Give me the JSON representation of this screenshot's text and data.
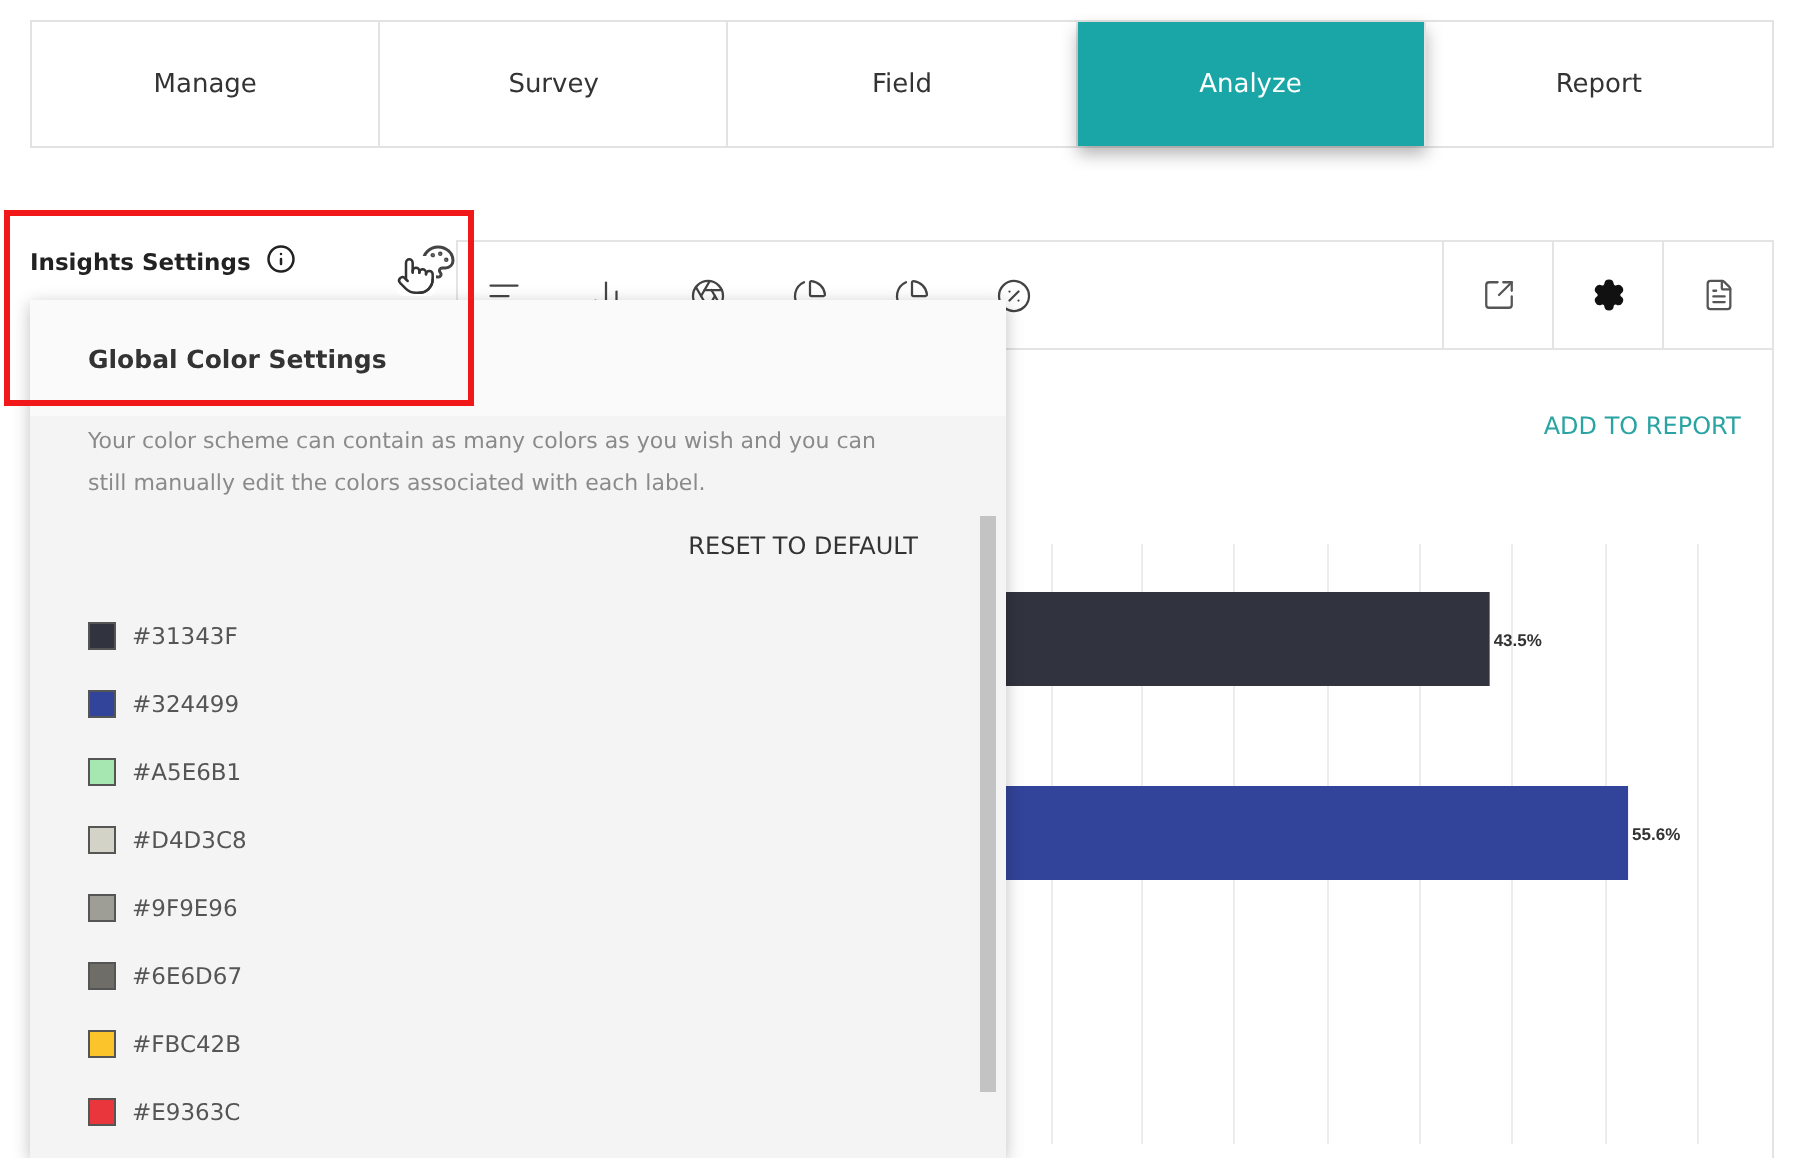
{
  "tabs": [
    {
      "label": "Manage",
      "selected": false
    },
    {
      "label": "Survey",
      "selected": false
    },
    {
      "label": "Field",
      "selected": false
    },
    {
      "label": "Analyze",
      "selected": true
    },
    {
      "label": "Report",
      "selected": false
    }
  ],
  "sidebar": {
    "title": "Insights Settings"
  },
  "toolbar": {
    "add_to_report": "ADD TO REPORT"
  },
  "color_popup": {
    "title": "Global Color Settings",
    "description": "Your color scheme can contain as many colors as you wish and you can still manually edit the colors associated with each label.",
    "reset": "RESET TO DEFAULT",
    "colors": [
      {
        "label": "#31343F",
        "color": "#31343f"
      },
      {
        "label": "#324499",
        "color": "#324499"
      },
      {
        "label": "#A5E6B1",
        "color": "#a5e6b1"
      },
      {
        "label": "#D4D3C8",
        "color": "#d4d3c8"
      },
      {
        "label": "#9F9E96",
        "color": "#9f9e96"
      },
      {
        "label": "#6E6D67",
        "color": "#6e6d67"
      },
      {
        "label": "#FBC42B",
        "color": "#fbc42b"
      },
      {
        "label": "#E9363C",
        "color": "#e9363c"
      }
    ]
  },
  "results": [
    {
      "label": "43.5%"
    },
    {
      "label": "55.6%"
    }
  ]
}
